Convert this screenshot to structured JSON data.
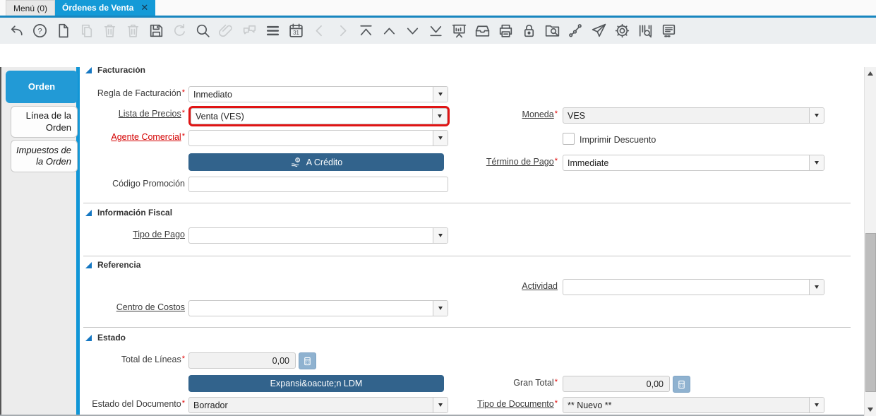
{
  "required_marker": "*",
  "window": {
    "tab_menu": "Menú (0)",
    "tab_active": "Órdenes de Venta",
    "close_glyph": "✕"
  },
  "colors": {
    "accent_blue": "#149ad7",
    "sidebar_strip_blue": "#1196d6",
    "button_blue": "#32638c",
    "calc_button_blue": "#8fb2d0",
    "mandatory_red": "#d40000",
    "highlight_red": "#e01414",
    "section_triangle_blue": "#1577c2"
  },
  "toolbar": {
    "icons": [
      {
        "name": "undo-icon",
        "enabled": true
      },
      {
        "name": "help-icon",
        "enabled": true
      },
      {
        "name": "new-record-icon",
        "enabled": true
      },
      {
        "name": "copy-record-icon",
        "enabled": false
      },
      {
        "name": "delete-record-icon",
        "enabled": false
      },
      {
        "name": "delete-selection-icon",
        "enabled": false
      },
      {
        "name": "save-icon",
        "enabled": true
      },
      {
        "name": "refresh-icon",
        "enabled": false
      },
      {
        "name": "find-icon",
        "enabled": true
      },
      {
        "name": "attachment-icon",
        "enabled": false
      },
      {
        "name": "chat-icon",
        "enabled": false
      },
      {
        "name": "grid-toggle-icon",
        "enabled": true
      },
      {
        "name": "calendar-icon",
        "enabled": true
      },
      {
        "name": "chevron-left-icon",
        "enabled": false
      },
      {
        "name": "chevron-right-icon",
        "enabled": false
      },
      {
        "name": "first-record-icon",
        "enabled": true
      },
      {
        "name": "previous-record-icon",
        "enabled": true
      },
      {
        "name": "next-record-icon",
        "enabled": true
      },
      {
        "name": "last-record-icon",
        "enabled": true
      },
      {
        "name": "report-icon",
        "enabled": true
      },
      {
        "name": "archive-icon",
        "enabled": true
      },
      {
        "name": "print-icon",
        "enabled": true
      },
      {
        "name": "lock-icon",
        "enabled": true
      },
      {
        "name": "zoom-across-icon",
        "enabled": true
      },
      {
        "name": "workflow-icon",
        "enabled": true
      },
      {
        "name": "send-icon",
        "enabled": true
      },
      {
        "name": "preferences-icon",
        "enabled": true
      },
      {
        "name": "product-info-icon",
        "enabled": true
      },
      {
        "name": "quick-form-icon",
        "enabled": true
      }
    ]
  },
  "sidebar": {
    "tabs": [
      {
        "label": "Orden",
        "active": true,
        "italic": false
      },
      {
        "label": "Línea de la Orden",
        "active": false,
        "italic": false
      },
      {
        "label": "Impuestos de la Orden",
        "active": false,
        "italic": true
      }
    ]
  },
  "sections": {
    "facturacion": {
      "title": "Facturación",
      "regla_label": "Regla de Facturación",
      "regla_value": "Inmediato",
      "lista_label": "Lista de Precios",
      "lista_value": "Venta (VES)",
      "moneda_label": "Moneda",
      "moneda_value": "VES",
      "agente_label": "Agente Comercial",
      "agente_value": "",
      "imprimir_label": "Imprimir Descuento",
      "imprimir_checked": false,
      "credito_button": "A Crédito",
      "termino_label": "Término de Pago",
      "termino_value": "Immediate",
      "codigo_label": "Código Promoción",
      "codigo_value": ""
    },
    "fiscal": {
      "title": "Información Fiscal",
      "tipo_pago_label": "Tipo de Pago",
      "tipo_pago_value": ""
    },
    "referencia": {
      "title": "Referencia",
      "actividad_label": "Actividad",
      "actividad_value": "",
      "centro_label": "Centro de Costos",
      "centro_value": ""
    },
    "estado": {
      "title": "Estado",
      "total_lineas_label": "Total de Líneas",
      "total_lineas_value": "0,00",
      "expansion_button": "Expansi&oacute;n LDM",
      "gran_total_label": "Gran Total",
      "gran_total_value": "0,00",
      "estado_doc_label": "Estado del Documento",
      "estado_doc_value": "Borrador",
      "tipo_doc_label": "Tipo de Documento",
      "tipo_doc_value": "** Nuevo **"
    }
  }
}
